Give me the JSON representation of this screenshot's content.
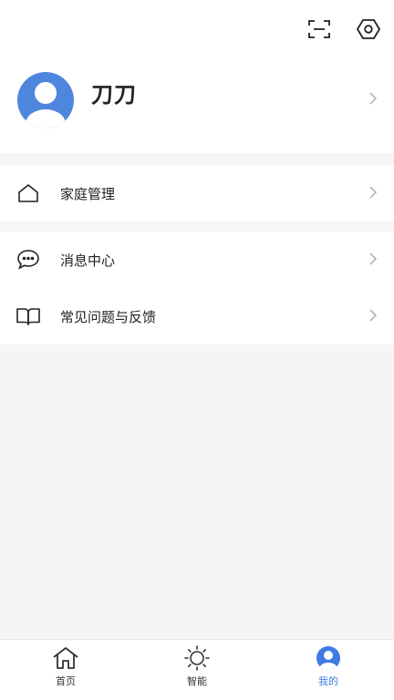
{
  "header": {
    "scan_icon": "scan-icon",
    "settings_icon": "settings-hexagon-icon"
  },
  "profile": {
    "name": "刀刀",
    "avatar_color": "#4f86dd"
  },
  "menu": {
    "home_management": "家庭管理",
    "message_center": "消息中心",
    "faq_feedback": "常见问题与反馈"
  },
  "tabs": [
    {
      "label": "首页",
      "icon": "home-icon"
    },
    {
      "label": "智能",
      "icon": "sun-icon"
    },
    {
      "label": "我的",
      "icon": "user-icon",
      "active": true
    }
  ],
  "colors": {
    "accent": "#3f7be0",
    "background": "#f5f5f5"
  }
}
